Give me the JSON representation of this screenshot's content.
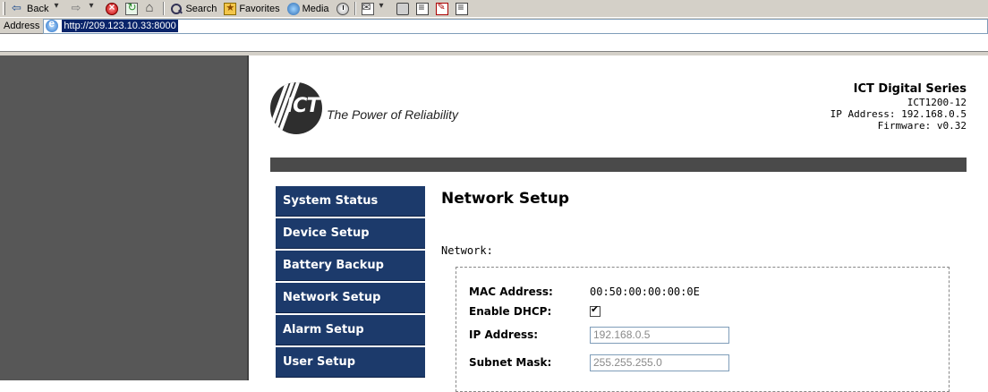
{
  "toolbar": {
    "back_label": "Back",
    "search_label": "Search",
    "favorites_label": "Favorites",
    "media_label": "Media"
  },
  "address_bar": {
    "label": "Address",
    "url": "http://209.123.10.33:8000"
  },
  "header": {
    "logo_text": "ICT",
    "tagline": "The Power of Reliability",
    "series": "ICT Digital Series",
    "model": "ICT1200-12",
    "ip_address": "IP Address: 192.168.0.5",
    "firmware": "Firmware: v0.32"
  },
  "nav": {
    "items": [
      {
        "label": "System Status"
      },
      {
        "label": "Device Setup"
      },
      {
        "label": "Battery Backup"
      },
      {
        "label": "Network Setup"
      },
      {
        "label": "Alarm Setup"
      },
      {
        "label": "User Setup"
      }
    ]
  },
  "main": {
    "title": "Network Setup",
    "section_label": "Network:",
    "fields": {
      "mac_label": "MAC Address:",
      "mac_value": "00:50:00:00:00:0E",
      "dhcp_label": "Enable DHCP:",
      "dhcp_checked": true,
      "ip_label": "IP Address:",
      "ip_value": "192.168.0.5",
      "subnet_label": "Subnet Mask:",
      "subnet_value": "255.255.255.0"
    }
  },
  "colors": {
    "nav_bg": "#1c3a6b",
    "left_frame_bg": "#575757",
    "header_bar": "#4a4a4a",
    "chrome": "#d4d0c8"
  }
}
